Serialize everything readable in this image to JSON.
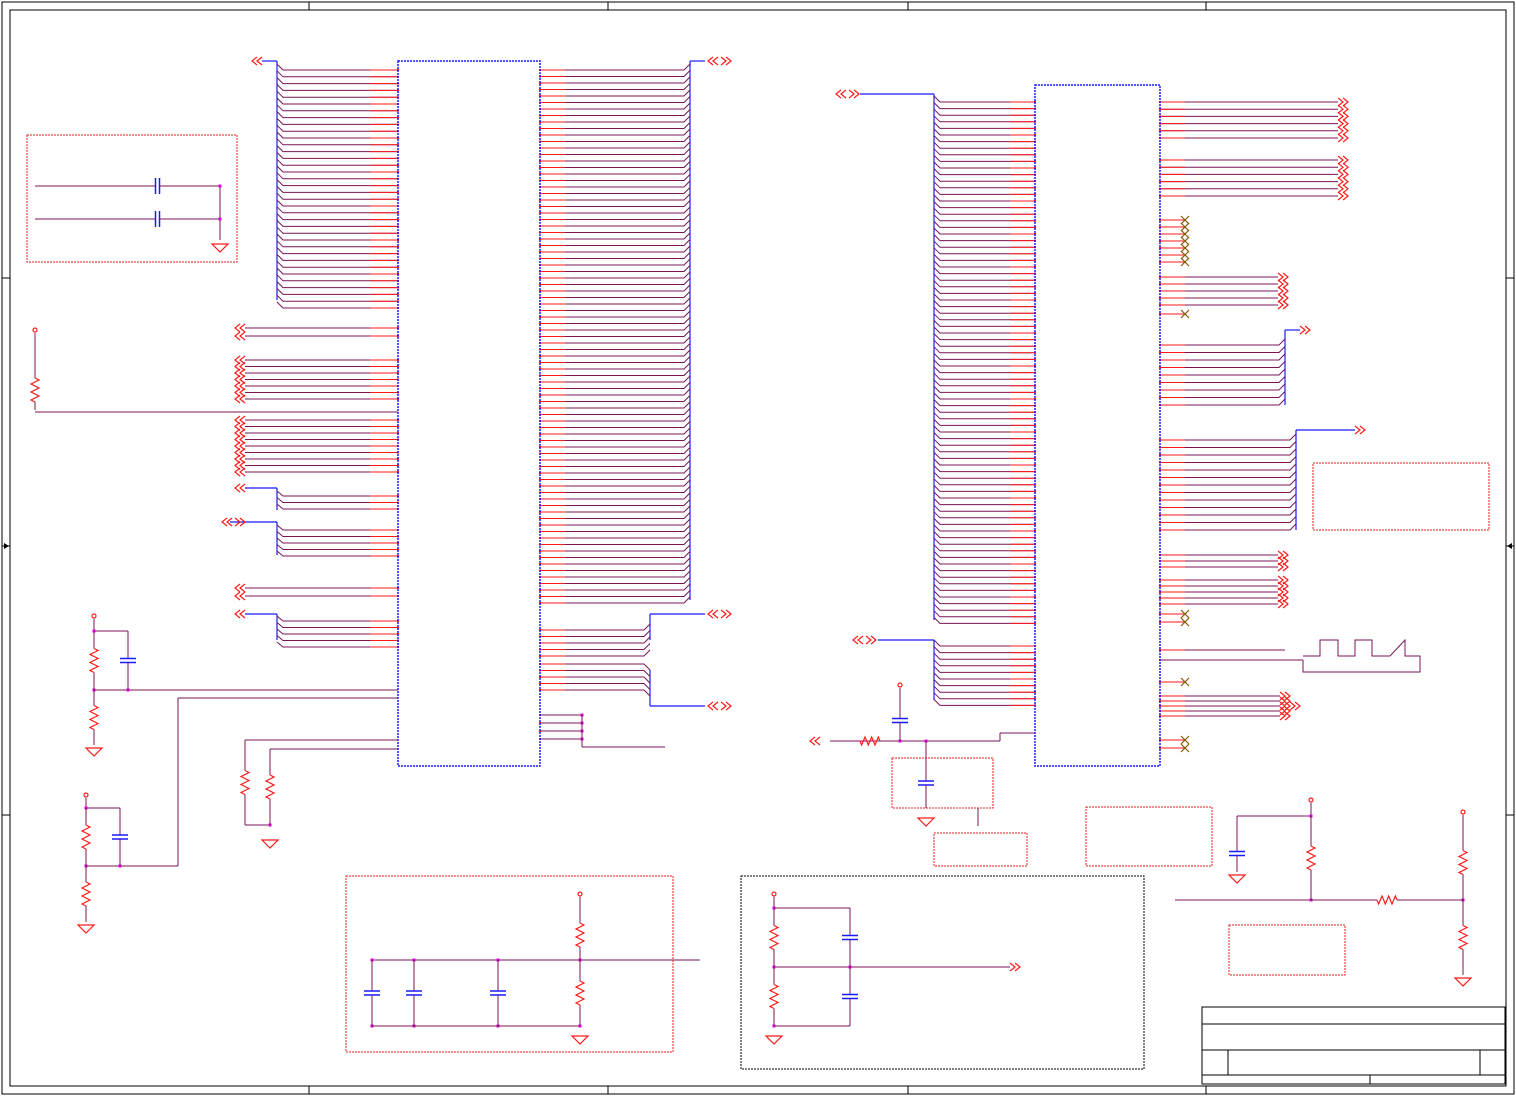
{
  "diagram": {
    "kind": "electronic schematic sheet",
    "text_labels": [],
    "colors": {
      "sheet_border": "#000000",
      "bus_blue": "#1a1aff",
      "wire_purple": "#7a1456",
      "pin_red": "#ff1a1a",
      "junction_magenta": "#e000e0",
      "no_connect_brown": "#8b5a00",
      "block_dashed_red": "#e02020",
      "block_dashed_black": "#000000"
    },
    "symbols": {
      "left_ic": "ic-body",
      "right_ic": "ic-body",
      "resistor": "resistor-symbol",
      "capacitor": "capacitor-symbol",
      "ground": "ground-symbol",
      "power_pin": "power-pin-symbol",
      "off_page_connector": "off-page-connector-symbol",
      "no_connect": "no-connect-x-symbol"
    }
  }
}
